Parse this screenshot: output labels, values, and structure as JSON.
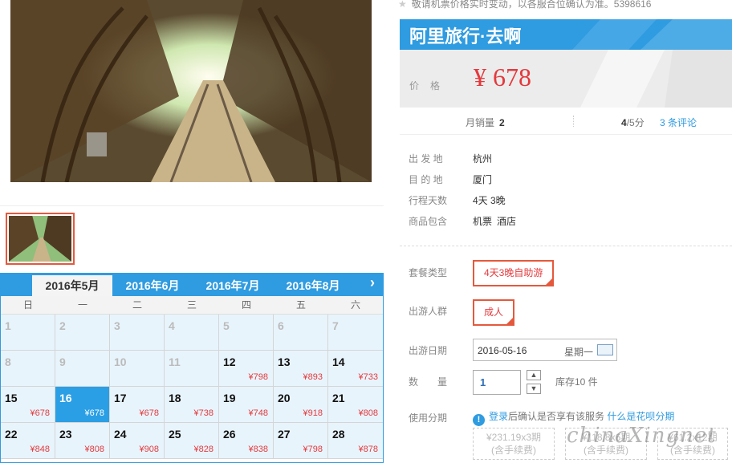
{
  "notice": "敬请机票价格实时变动，以各服合位确认为准。5398616",
  "brand": "阿里旅行·去啊",
  "price": {
    "label": "价格",
    "value": "¥ 678"
  },
  "stats": {
    "sold_label": "月销量",
    "sold_value": "2",
    "score": "4",
    "score_suffix": "/5分",
    "reviews": "3 条评论"
  },
  "info": [
    {
      "key": "出 发 地",
      "value": "杭州"
    },
    {
      "key": "目 的 地",
      "value": "厦门"
    },
    {
      "key": "行程天数",
      "value": "4天 3晚"
    },
    {
      "key": "商品包含",
      "value": "机票",
      "value2": "酒店"
    }
  ],
  "options": {
    "package_label": "套餐类型",
    "package_value": "4天3晚自助游",
    "crowd_label": "出游人群",
    "crowd_value": "成人",
    "date_label": "出游日期",
    "date_value": "2016-05-16",
    "date_weekday": "星期一",
    "qty_label": "数　　量",
    "qty_value": "1",
    "stock": "库存10 件",
    "install_label": "使用分期",
    "install_text": "登录",
    "install_middle": "后确认是否享有该服务",
    "install_link": "什么是花呗分期"
  },
  "plans": [
    {
      "line1": "¥231.19x3期",
      "line2": "(含手续费)"
    },
    {
      "line1": "¥118.8x6期",
      "line2": "(含手续费)"
    },
    {
      "line1": "¥61.2x12期",
      "line2": "(含手续费)"
    }
  ],
  "watermark": "chinaXingnet",
  "calendar": {
    "tabs": [
      "2016年5月",
      "2016年6月",
      "2016年7月",
      "2016年8月"
    ],
    "active_tab": 0,
    "weekdays": [
      "日",
      "一",
      "二",
      "三",
      "四",
      "五",
      "六"
    ],
    "cells": [
      {
        "day": "1",
        "price": "",
        "state": "disabled"
      },
      {
        "day": "2",
        "price": "",
        "state": "disabled"
      },
      {
        "day": "3",
        "price": "",
        "state": "disabled"
      },
      {
        "day": "4",
        "price": "",
        "state": "disabled"
      },
      {
        "day": "5",
        "price": "",
        "state": "disabled"
      },
      {
        "day": "6",
        "price": "",
        "state": "disabled"
      },
      {
        "day": "7",
        "price": "",
        "state": "disabled"
      },
      {
        "day": "8",
        "price": "",
        "state": "disabled"
      },
      {
        "day": "9",
        "price": "",
        "state": "disabled"
      },
      {
        "day": "10",
        "price": "",
        "state": "disabled"
      },
      {
        "day": "11",
        "price": "",
        "state": "disabled"
      },
      {
        "day": "12",
        "price": "¥798",
        "state": "enabled"
      },
      {
        "day": "13",
        "price": "¥893",
        "state": "enabled"
      },
      {
        "day": "14",
        "price": "¥733",
        "state": "enabled"
      },
      {
        "day": "15",
        "price": "¥678",
        "state": "enabled"
      },
      {
        "day": "16",
        "price": "¥678",
        "state": "selected"
      },
      {
        "day": "17",
        "price": "¥678",
        "state": "enabled"
      },
      {
        "day": "18",
        "price": "¥738",
        "state": "enabled"
      },
      {
        "day": "19",
        "price": "¥748",
        "state": "enabled"
      },
      {
        "day": "20",
        "price": "¥918",
        "state": "enabled"
      },
      {
        "day": "21",
        "price": "¥808",
        "state": "enabled"
      },
      {
        "day": "22",
        "price": "¥848",
        "state": "enabled"
      },
      {
        "day": "23",
        "price": "¥808",
        "state": "enabled"
      },
      {
        "day": "24",
        "price": "¥908",
        "state": "enabled"
      },
      {
        "day": "25",
        "price": "¥828",
        "state": "enabled"
      },
      {
        "day": "26",
        "price": "¥838",
        "state": "enabled"
      },
      {
        "day": "27",
        "price": "¥798",
        "state": "enabled"
      },
      {
        "day": "28",
        "price": "¥878",
        "state": "enabled"
      }
    ]
  }
}
